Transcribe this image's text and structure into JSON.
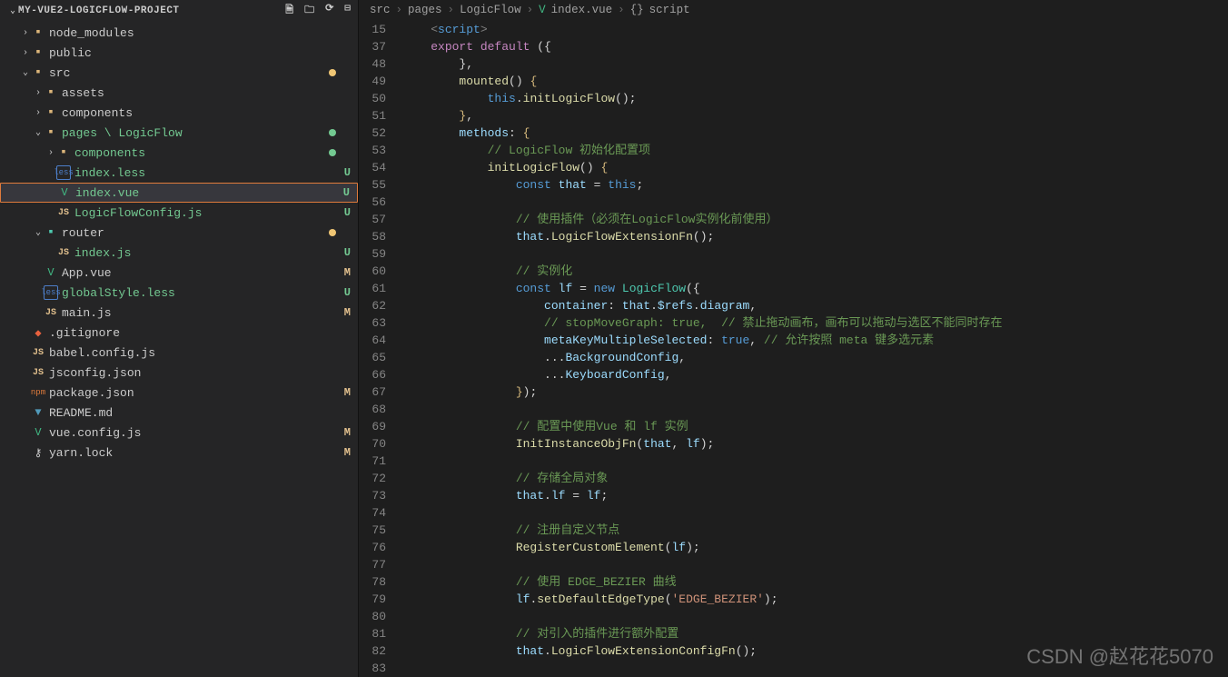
{
  "sidebar": {
    "title": "MY-VUE2-LOGICFLOW-PROJECT",
    "header_icons": [
      "new-file",
      "new-folder",
      "refresh",
      "collapse"
    ],
    "tree": [
      {
        "indent": 1,
        "twisty": ">",
        "icon": "folder",
        "iconClass": "ic-folder",
        "label": "node_modules"
      },
      {
        "indent": 1,
        "twisty": ">",
        "icon": "folder",
        "iconClass": "ic-folder",
        "label": "public"
      },
      {
        "indent": 1,
        "twisty": "v",
        "icon": "folder",
        "iconClass": "ic-folder",
        "label": "src",
        "dot": "amber"
      },
      {
        "indent": 2,
        "twisty": ">",
        "icon": "folder",
        "iconClass": "ic-folder",
        "label": "assets"
      },
      {
        "indent": 2,
        "twisty": ">",
        "icon": "folder",
        "iconClass": "ic-folder",
        "label": "components"
      },
      {
        "indent": 2,
        "twisty": "v",
        "icon": "folder",
        "iconClass": "ic-folder",
        "label": "pages \\ LogicFlow",
        "dot": "green",
        "green": true
      },
      {
        "indent": 3,
        "twisty": ">",
        "icon": "folder",
        "iconClass": "ic-folder",
        "label": "components",
        "dot": "green",
        "green": true
      },
      {
        "indent": 3,
        "twisty": "",
        "icon": "less",
        "iconClass": "ic-less",
        "label": "index.less",
        "status": "U",
        "green": true
      },
      {
        "indent": 3,
        "twisty": "",
        "icon": "V",
        "iconClass": "ic-vue",
        "label": "index.vue",
        "status": "U",
        "green": true,
        "active": true,
        "boxed": true
      },
      {
        "indent": 3,
        "twisty": "",
        "icon": "JS",
        "iconClass": "ic-js",
        "label": "LogicFlowConfig.js",
        "status": "U",
        "green": true
      },
      {
        "indent": 2,
        "twisty": "v",
        "icon": "folder",
        "iconClass": "ic-router",
        "label": "router",
        "dot": "amber"
      },
      {
        "indent": 3,
        "twisty": "",
        "icon": "JS",
        "iconClass": "ic-js",
        "label": "index.js",
        "status": "U",
        "green": true
      },
      {
        "indent": 2,
        "twisty": "",
        "icon": "V",
        "iconClass": "ic-vue",
        "label": "App.vue",
        "status": "M"
      },
      {
        "indent": 2,
        "twisty": "",
        "icon": "less",
        "iconClass": "ic-less",
        "label": "globalStyle.less",
        "status": "U",
        "green": true
      },
      {
        "indent": 2,
        "twisty": "",
        "icon": "JS",
        "iconClass": "ic-js",
        "label": "main.js",
        "status": "M"
      },
      {
        "indent": 1,
        "twisty": "",
        "icon": "◆",
        "iconClass": "ic-git",
        "label": ".gitignore"
      },
      {
        "indent": 1,
        "twisty": "",
        "icon": "JS",
        "iconClass": "ic-js",
        "label": "babel.config.js"
      },
      {
        "indent": 1,
        "twisty": "",
        "icon": "JS",
        "iconClass": "ic-js",
        "label": "jsconfig.json"
      },
      {
        "indent": 1,
        "twisty": "",
        "icon": "npm",
        "iconClass": "ic-json",
        "label": "package.json",
        "status": "M"
      },
      {
        "indent": 1,
        "twisty": "",
        "icon": "▼",
        "iconClass": "ic-md",
        "label": "README.md"
      },
      {
        "indent": 1,
        "twisty": "",
        "icon": "V",
        "iconClass": "ic-vue",
        "label": "vue.config.js",
        "status": "M"
      },
      {
        "indent": 1,
        "twisty": "",
        "icon": "⚷",
        "iconClass": "ic-lock",
        "label": "yarn.lock",
        "status": "M"
      }
    ]
  },
  "breadcrumb": [
    {
      "label": "src"
    },
    {
      "label": "pages"
    },
    {
      "label": "LogicFlow"
    },
    {
      "icon": "V",
      "iconClass": "ic-vue",
      "label": "index.vue"
    },
    {
      "icon": "{}",
      "label": "script"
    }
  ],
  "code": {
    "lines": [
      {
        "n": 15,
        "tokens": [
          [
            "    ",
            ""
          ],
          [
            "<",
            "tk-tag"
          ],
          [
            "script",
            "tk-control"
          ],
          [
            ">",
            "tk-tag"
          ]
        ]
      },
      {
        "n": 37,
        "tokens": [
          [
            "    ",
            ""
          ],
          [
            "export default",
            "tk-keyword"
          ],
          [
            " ({",
            "tk-punc"
          ]
        ]
      },
      {
        "n": 48,
        "tokens": [
          [
            "        },",
            "tk-punc"
          ]
        ]
      },
      {
        "n": 49,
        "tokens": [
          [
            "        ",
            ""
          ],
          [
            "mounted",
            "tk-fn"
          ],
          [
            "() ",
            "tk-punc"
          ],
          [
            "{",
            "tk-brace-y"
          ]
        ]
      },
      {
        "n": 50,
        "tokens": [
          [
            "            ",
            ""
          ],
          [
            "this",
            "tk-this"
          ],
          [
            ".",
            "tk-punc"
          ],
          [
            "initLogicFlow",
            "tk-fn"
          ],
          [
            "();",
            "tk-punc"
          ]
        ]
      },
      {
        "n": 51,
        "tokens": [
          [
            "        ",
            ""
          ],
          [
            "}",
            "tk-brace-y"
          ],
          [
            ",",
            "tk-punc"
          ]
        ]
      },
      {
        "n": 52,
        "tokens": [
          [
            "        ",
            ""
          ],
          [
            "methods",
            "tk-field"
          ],
          [
            ": ",
            "tk-punc"
          ],
          [
            "{",
            "tk-brace-y"
          ]
        ]
      },
      {
        "n": 53,
        "tokens": [
          [
            "            ",
            ""
          ],
          [
            "// LogicFlow 初始化配置项",
            "tk-comment"
          ]
        ]
      },
      {
        "n": 54,
        "tokens": [
          [
            "            ",
            ""
          ],
          [
            "initLogicFlow",
            "tk-fn"
          ],
          [
            "() ",
            "tk-punc"
          ],
          [
            "{",
            "tk-brace-y"
          ]
        ]
      },
      {
        "n": 55,
        "tokens": [
          [
            "                ",
            ""
          ],
          [
            "const",
            "tk-const"
          ],
          [
            " ",
            ""
          ],
          [
            "that",
            "tk-var"
          ],
          [
            " = ",
            "tk-punc"
          ],
          [
            "this",
            "tk-this"
          ],
          [
            ";",
            "tk-punc"
          ]
        ]
      },
      {
        "n": 56,
        "tokens": [
          [
            "",
            ""
          ]
        ]
      },
      {
        "n": 57,
        "tokens": [
          [
            "                ",
            ""
          ],
          [
            "// 使用插件（必须在LogicFlow实例化前使用）",
            "tk-comment"
          ]
        ]
      },
      {
        "n": 58,
        "tokens": [
          [
            "                ",
            ""
          ],
          [
            "that",
            "tk-var"
          ],
          [
            ".",
            "tk-punc"
          ],
          [
            "LogicFlowExtensionFn",
            "tk-fn"
          ],
          [
            "();",
            "tk-punc"
          ]
        ]
      },
      {
        "n": 59,
        "tokens": [
          [
            "",
            ""
          ]
        ]
      },
      {
        "n": 60,
        "tokens": [
          [
            "                ",
            ""
          ],
          [
            "// 实例化",
            "tk-comment"
          ]
        ]
      },
      {
        "n": 61,
        "tokens": [
          [
            "                ",
            ""
          ],
          [
            "const",
            "tk-const"
          ],
          [
            " ",
            ""
          ],
          [
            "lf",
            "tk-var"
          ],
          [
            " = ",
            "tk-punc"
          ],
          [
            "new",
            "tk-const"
          ],
          [
            " ",
            ""
          ],
          [
            "LogicFlow",
            "tk-type"
          ],
          [
            "({",
            "tk-punc"
          ]
        ]
      },
      {
        "n": 62,
        "tokens": [
          [
            "                    ",
            ""
          ],
          [
            "container",
            "tk-field"
          ],
          [
            ": ",
            "tk-punc"
          ],
          [
            "that",
            "tk-var"
          ],
          [
            ".",
            "tk-punc"
          ],
          [
            "$refs",
            "tk-var"
          ],
          [
            ".",
            "tk-punc"
          ],
          [
            "diagram",
            "tk-var"
          ],
          [
            ",",
            "tk-punc"
          ]
        ]
      },
      {
        "n": 63,
        "tokens": [
          [
            "                    ",
            ""
          ],
          [
            "// stopMoveGraph: true,  // 禁止拖动画布，画布可以拖动与选区不能同时存在",
            "tk-comment"
          ]
        ]
      },
      {
        "n": 64,
        "tokens": [
          [
            "                    ",
            ""
          ],
          [
            "metaKeyMultipleSelected",
            "tk-field"
          ],
          [
            ": ",
            "tk-punc"
          ],
          [
            "true",
            "tk-const"
          ],
          [
            ",",
            "tk-punc"
          ],
          [
            " ",
            ""
          ],
          [
            "// 允许按照 meta 键多选元素",
            "tk-comment"
          ]
        ]
      },
      {
        "n": 65,
        "tokens": [
          [
            "                    ...",
            "tk-punc"
          ],
          [
            "BackgroundConfig",
            "tk-var"
          ],
          [
            ",",
            "tk-punc"
          ]
        ]
      },
      {
        "n": 66,
        "tokens": [
          [
            "                    ...",
            "tk-punc"
          ],
          [
            "KeyboardConfig",
            "tk-var"
          ],
          [
            ",",
            "tk-punc"
          ]
        ]
      },
      {
        "n": 67,
        "tokens": [
          [
            "                ",
            ""
          ],
          [
            "}",
            "tk-brace-y"
          ],
          [
            ");",
            "tk-punc"
          ]
        ]
      },
      {
        "n": 68,
        "tokens": [
          [
            "",
            ""
          ]
        ]
      },
      {
        "n": 69,
        "tokens": [
          [
            "                ",
            ""
          ],
          [
            "// 配置中使用Vue 和 lf 实例",
            "tk-comment"
          ]
        ]
      },
      {
        "n": 70,
        "tokens": [
          [
            "                ",
            ""
          ],
          [
            "InitInstanceObjFn",
            "tk-fn"
          ],
          [
            "(",
            "tk-punc"
          ],
          [
            "that",
            "tk-var"
          ],
          [
            ", ",
            "tk-punc"
          ],
          [
            "lf",
            "tk-var"
          ],
          [
            ");",
            "tk-punc"
          ]
        ]
      },
      {
        "n": 71,
        "tokens": [
          [
            "",
            ""
          ]
        ]
      },
      {
        "n": 72,
        "tokens": [
          [
            "                ",
            ""
          ],
          [
            "// 存储全局对象",
            "tk-comment"
          ]
        ]
      },
      {
        "n": 73,
        "tokens": [
          [
            "                ",
            ""
          ],
          [
            "that",
            "tk-var"
          ],
          [
            ".",
            "tk-punc"
          ],
          [
            "lf",
            "tk-var"
          ],
          [
            " = ",
            "tk-punc"
          ],
          [
            "lf",
            "tk-var"
          ],
          [
            ";",
            "tk-punc"
          ]
        ]
      },
      {
        "n": 74,
        "tokens": [
          [
            "",
            ""
          ]
        ]
      },
      {
        "n": 75,
        "tokens": [
          [
            "                ",
            ""
          ],
          [
            "// 注册自定义节点",
            "tk-comment"
          ]
        ]
      },
      {
        "n": 76,
        "tokens": [
          [
            "                ",
            ""
          ],
          [
            "RegisterCustomElement",
            "tk-fn"
          ],
          [
            "(",
            "tk-punc"
          ],
          [
            "lf",
            "tk-var"
          ],
          [
            ");",
            "tk-punc"
          ]
        ]
      },
      {
        "n": 77,
        "tokens": [
          [
            "",
            ""
          ]
        ]
      },
      {
        "n": 78,
        "tokens": [
          [
            "                ",
            ""
          ],
          [
            "// 使用 EDGE_BEZIER 曲线",
            "tk-comment"
          ]
        ]
      },
      {
        "n": 79,
        "tokens": [
          [
            "                ",
            ""
          ],
          [
            "lf",
            "tk-var"
          ],
          [
            ".",
            "tk-punc"
          ],
          [
            "setDefaultEdgeType",
            "tk-fn"
          ],
          [
            "(",
            "tk-punc"
          ],
          [
            "'EDGE_BEZIER'",
            "tk-str"
          ],
          [
            ");",
            "tk-punc"
          ]
        ]
      },
      {
        "n": 80,
        "tokens": [
          [
            "",
            ""
          ]
        ]
      },
      {
        "n": 81,
        "tokens": [
          [
            "                ",
            ""
          ],
          [
            "// 对引入的插件进行额外配置",
            "tk-comment"
          ]
        ]
      },
      {
        "n": 82,
        "tokens": [
          [
            "                ",
            ""
          ],
          [
            "that",
            "tk-var"
          ],
          [
            ".",
            "tk-punc"
          ],
          [
            "LogicFlowExtensionConfigFn",
            "tk-fn"
          ],
          [
            "();",
            "tk-punc"
          ]
        ]
      },
      {
        "n": 83,
        "tokens": [
          [
            "",
            ""
          ]
        ]
      }
    ]
  },
  "watermark": "CSDN @赵花花5070"
}
